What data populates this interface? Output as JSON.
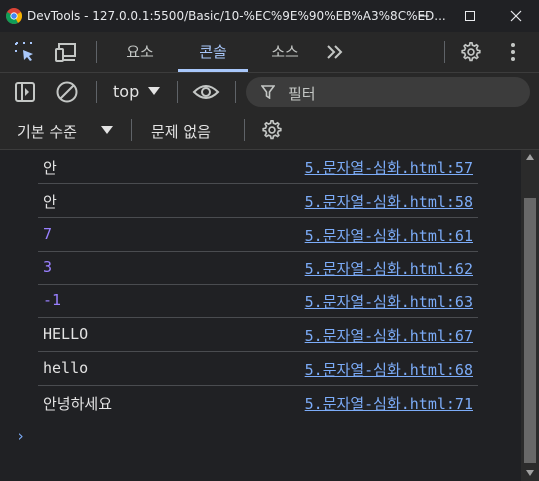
{
  "window": {
    "title": "DevTools - 127.0.0.1:5500/Basic/10-%EC%9E%90%EB%A3%8C%ED..."
  },
  "tabs": {
    "items": [
      "요소",
      "콘솔",
      "소스"
    ],
    "active": "콘솔"
  },
  "toolbar": {
    "context": "top",
    "filter_placeholder": "필터",
    "log_level": "기본 수준",
    "issues": "문제 없음"
  },
  "console": {
    "rows": [
      {
        "message": "안",
        "source": "5.문자열-심화.html:57",
        "type": "string"
      },
      {
        "message": "안",
        "source": "5.문자열-심화.html:58",
        "type": "string"
      },
      {
        "message": "7",
        "source": "5.문자열-심화.html:61",
        "type": "number"
      },
      {
        "message": "3",
        "source": "5.문자열-심화.html:62",
        "type": "number"
      },
      {
        "message": "-1",
        "source": "5.문자열-심화.html:63",
        "type": "number"
      },
      {
        "message": "HELLO",
        "source": "5.문자열-심화.html:67",
        "type": "string"
      },
      {
        "message": "hello",
        "source": "5.문자열-심화.html:68",
        "type": "string"
      },
      {
        "message": "안녕하세요",
        "source": "5.문자열-심화.html:71",
        "type": "string"
      }
    ],
    "prompt": "›"
  },
  "colors": {
    "accent": "#a8c7fa",
    "number": "#9980ff",
    "link": "#7cacf8",
    "background": "#202124"
  }
}
